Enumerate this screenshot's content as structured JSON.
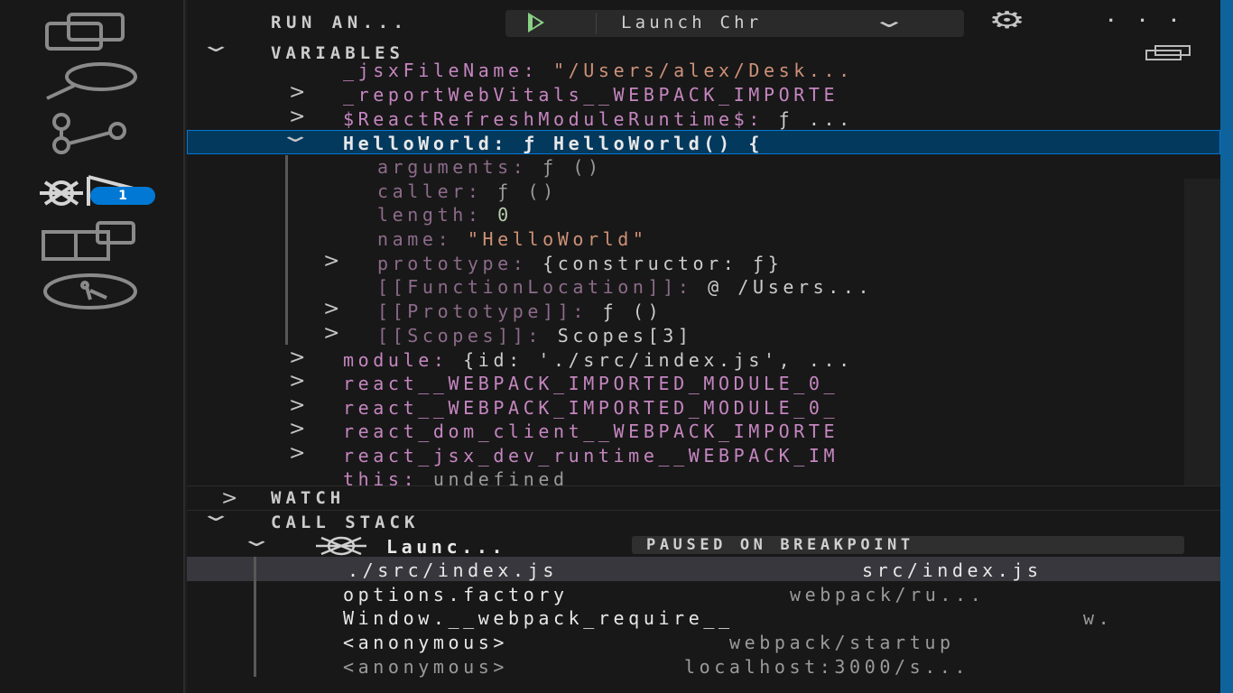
{
  "toolbar": {
    "section_title": "RUN AN...",
    "launch_config": "Launch Chr",
    "more": "· · ·"
  },
  "variables": {
    "header": "VARIABLES",
    "rows": [
      {
        "name": "_jsxFileName:",
        "value": "\"/Users/alex/Desk..."
      },
      {
        "name": "_reportWebVitals__WEBPACK_IMPORTE",
        "value": ""
      },
      {
        "name": "$ReactRefreshModuleRuntime$:",
        "value": "ƒ ..."
      },
      {
        "name": "HelloWorld:",
        "value": "ƒ HelloWorld() {"
      },
      {
        "name": "arguments:",
        "value": "ƒ ()"
      },
      {
        "name": "caller:",
        "value": "ƒ ()"
      },
      {
        "name": "length:",
        "value": "0"
      },
      {
        "name": "name:",
        "value": "\"HelloWorld\""
      },
      {
        "name": "prototype:",
        "value": "{constructor: ƒ}"
      },
      {
        "name": "[[FunctionLocation]]:",
        "value": "@ /Users..."
      },
      {
        "name": "[[Prototype]]:",
        "value": "ƒ ()"
      },
      {
        "name": "[[Scopes]]:",
        "value": "Scopes[3]"
      },
      {
        "name": "module:",
        "value": "{id: './src/index.js', ..."
      },
      {
        "name": "react__WEBPACK_IMPORTED_MODULE_0_",
        "value": ""
      },
      {
        "name": "react__WEBPACK_IMPORTED_MODULE_0_",
        "value": ""
      },
      {
        "name": "react_dom_client__WEBPACK_IMPORTE",
        "value": ""
      },
      {
        "name": "react_jsx_dev_runtime__WEBPACK_IM",
        "value": ""
      },
      {
        "name": "this:",
        "value": "undefined"
      }
    ]
  },
  "watch": {
    "header": "WATCH"
  },
  "call_stack": {
    "header": "CALL STACK",
    "session": "Launc...",
    "status": "PAUSED ON BREAKPOINT",
    "frames": [
      {
        "fn": "./src/index.js",
        "source": "src/index.js"
      },
      {
        "fn": "options.factory",
        "source": "webpack/ru..."
      },
      {
        "fn": "Window.__webpack_require__",
        "source": "w."
      },
      {
        "fn": "<anonymous>",
        "source": "webpack/startup"
      },
      {
        "fn": "<anonymous>",
        "source": "localhost:3000/s..."
      }
    ]
  },
  "activity": {
    "debug_badge": "1",
    "icons": [
      "explorer-icon",
      "search-icon",
      "source-control-icon",
      "run-debug-icon",
      "extensions-icon",
      "timeline-icon"
    ]
  },
  "colors": {
    "accent": "#0078d4",
    "variable_name": "#c586c0",
    "string": "#ce9178",
    "number": "#b5cea8",
    "play": "#89d185"
  }
}
